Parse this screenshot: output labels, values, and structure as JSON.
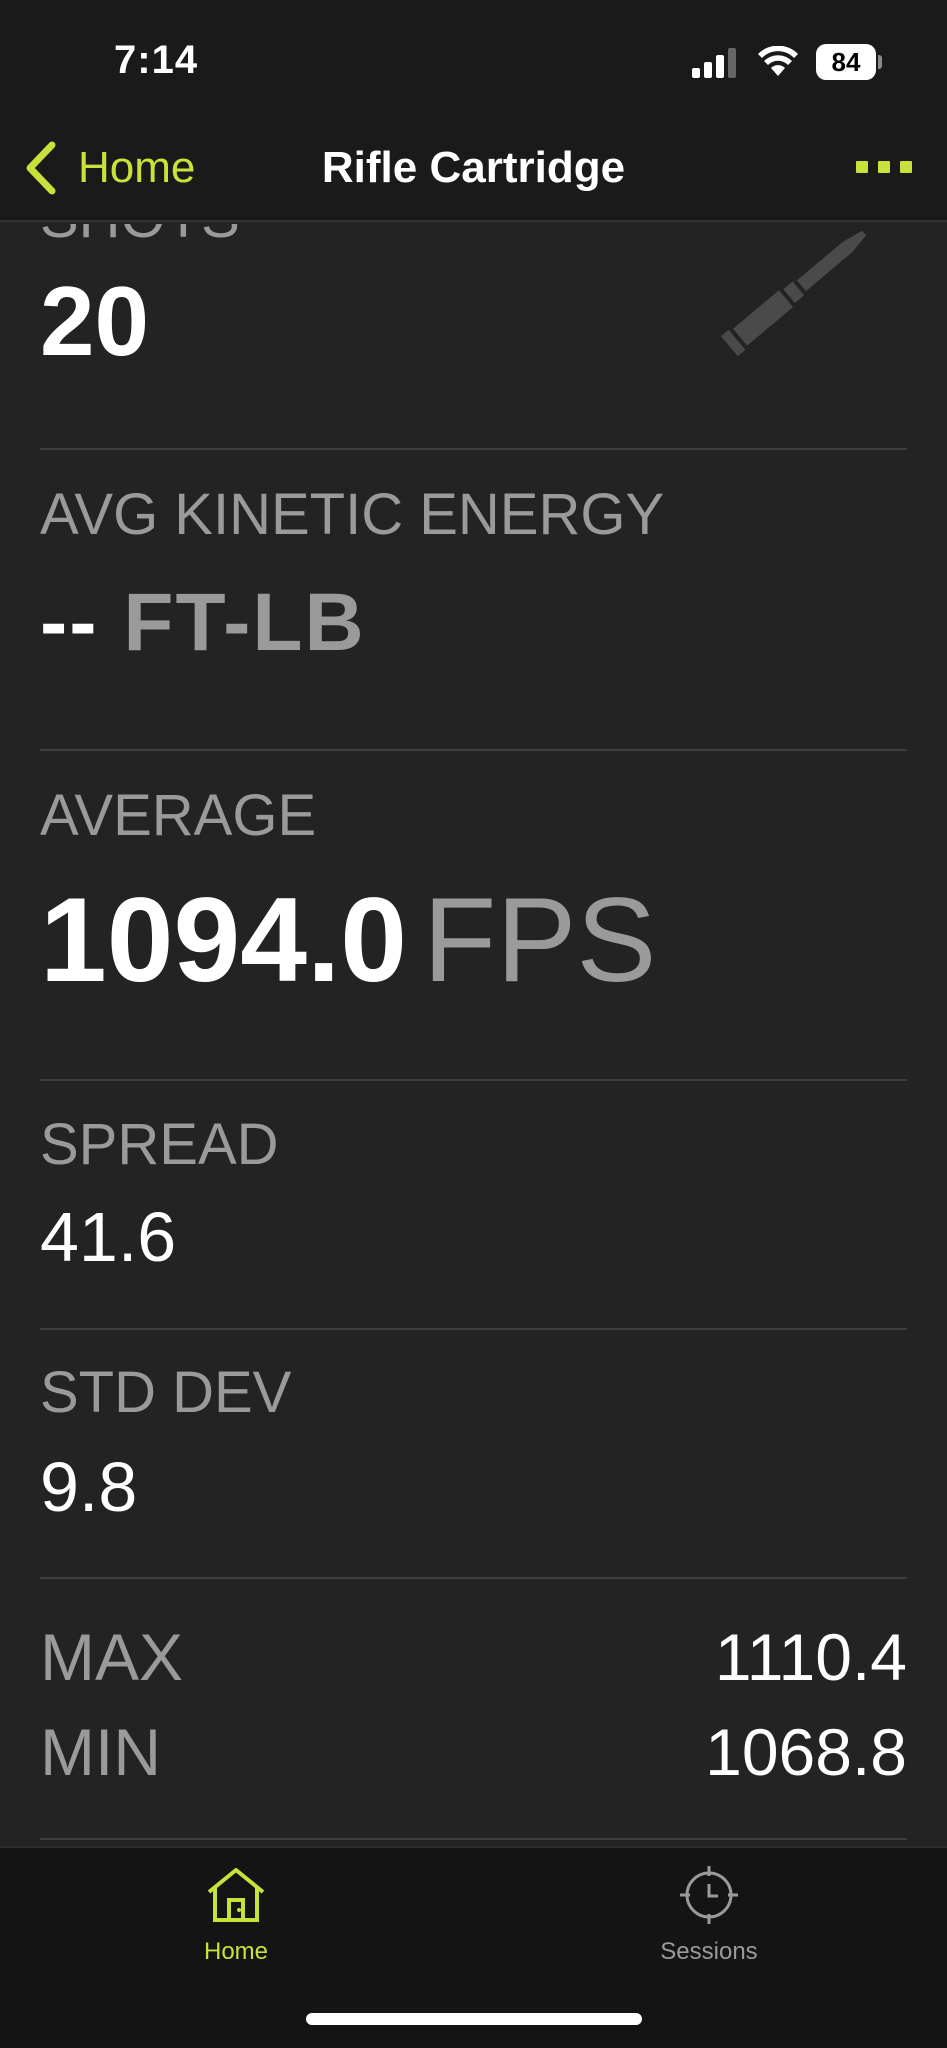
{
  "status_bar": {
    "time": "7:14",
    "battery": "84"
  },
  "nav": {
    "back_label": "Home",
    "title": "Rifle Cartridge",
    "more_icon": "ellipsis-icon"
  },
  "stats": {
    "shots": {
      "label": "SHOTS",
      "value": "20"
    },
    "kinetic_energy": {
      "label": "AVG KINETIC ENERGY",
      "value": "--",
      "unit": "FT-LB"
    },
    "average": {
      "label": "AVERAGE",
      "value": "1094.0",
      "unit": "FPS"
    },
    "spread": {
      "label": "SPREAD",
      "value": "41.6"
    },
    "std_dev": {
      "label": "STD DEV",
      "value": "9.8"
    },
    "max": {
      "label": "MAX",
      "value": "1110.4"
    },
    "min": {
      "label": "MIN",
      "value": "1068.8"
    }
  },
  "tabs": [
    {
      "label": "Home",
      "icon": "house-icon",
      "active": true
    },
    {
      "label": "Sessions",
      "icon": "crosshair-clock-icon",
      "active": false
    }
  ],
  "colors": {
    "accent": "#c9e13a",
    "background": "#232323",
    "secondary_text": "#9a9a9a"
  }
}
